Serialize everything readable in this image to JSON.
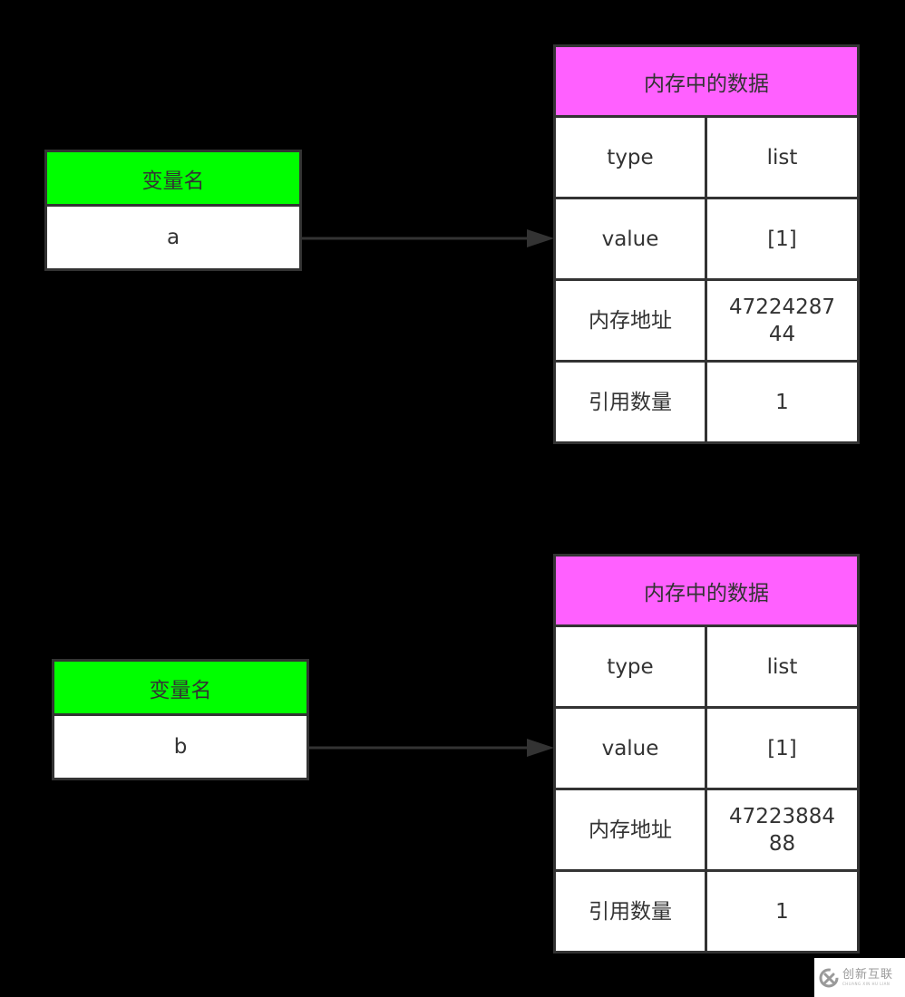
{
  "diagrams": [
    {
      "variable": {
        "header": "变量名",
        "name": "a"
      },
      "memory": {
        "header": "内存中的数据",
        "rows": [
          {
            "key": "type",
            "value": "list"
          },
          {
            "key": "value",
            "value": "[1]"
          },
          {
            "key": "内存地址",
            "value": "47224287\n44"
          },
          {
            "key": "引用数量",
            "value": "1"
          }
        ]
      }
    },
    {
      "variable": {
        "header": "变量名",
        "name": "b"
      },
      "memory": {
        "header": "内存中的数据",
        "rows": [
          {
            "key": "type",
            "value": "list"
          },
          {
            "key": "value",
            "value": "[1]"
          },
          {
            "key": "内存地址",
            "value": "47223884\n88"
          },
          {
            "key": "引用数量",
            "value": "1"
          }
        ]
      }
    }
  ],
  "watermark": {
    "icon": "logo-icon",
    "text": "创新互联",
    "subtext": "CHUANG XIN HU LIAN"
  },
  "colors": {
    "variable_header": "#00ff00",
    "memory_header": "#ff60ff",
    "border": "#333333",
    "background": "#000000"
  }
}
